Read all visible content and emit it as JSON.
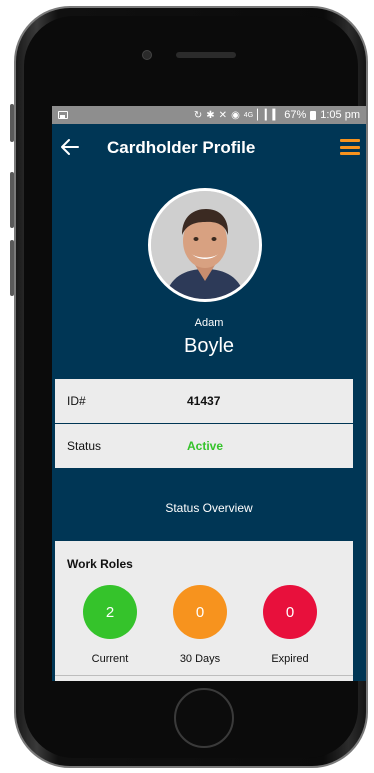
{
  "statusbar": {
    "icons": [
      "image-icon",
      "sync-icon",
      "bluetooth-icon",
      "mute-icon",
      "alarm-icon",
      "4g-icon",
      "signal-icon"
    ],
    "battery": "67%",
    "time": "1:05 pm"
  },
  "appbar": {
    "title": "Cardholder Profile"
  },
  "profile": {
    "first_name": "Adam",
    "last_name": "Boyle"
  },
  "info": {
    "id_label": "ID#",
    "id_value": "41437",
    "status_label": "Status",
    "status_value": "Active"
  },
  "overview": {
    "title": "Status Overview"
  },
  "work_roles": {
    "title": "Work Roles",
    "items": [
      {
        "count": "2",
        "label": "Current",
        "color": "#35c32b"
      },
      {
        "count": "0",
        "label": "30 Days",
        "color": "#f7931e"
      },
      {
        "count": "0",
        "label": "Expired",
        "color": "#e8103c"
      }
    ]
  },
  "colors": {
    "screen_bg": "#003655",
    "accent": "#f7931e",
    "active": "#35c32b"
  }
}
